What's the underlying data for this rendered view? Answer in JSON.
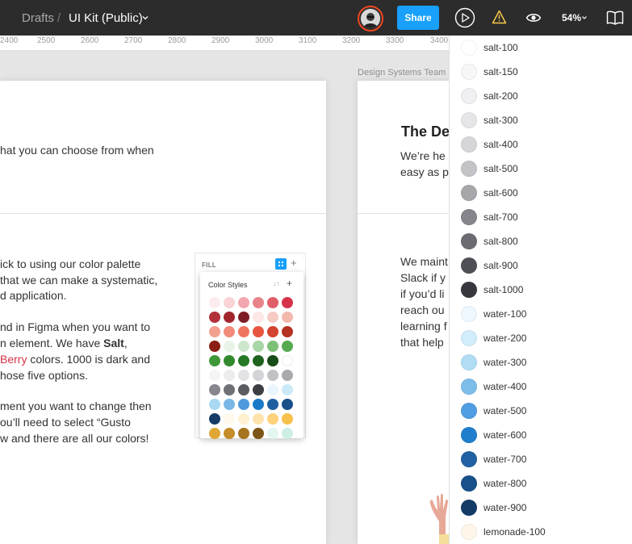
{
  "topbar": {
    "breadcrumb_parent": "Drafts",
    "breadcrumb_sep": "/",
    "file_name": "UI Kit (Public)",
    "share_label": "Share",
    "zoom": "54%"
  },
  "ruler": {
    "ticks": [
      "2400",
      "2500",
      "2600",
      "2700",
      "2800",
      "2900",
      "3000",
      "3100",
      "3200",
      "3300",
      "3400"
    ]
  },
  "canvas": {
    "frame_label": "Design Systems Team",
    "left_top_text": "hat you can choose from when",
    "left_para1": [
      "ick to using our color palette",
      "that we can make a systematic,",
      "d application."
    ],
    "left_para2_line1": "nd in Figma when you want to",
    "left_para2_line2_a": "n element. We have ",
    "left_para2_line2_b": "Salt",
    "left_para2_line2_c": ",",
    "left_para2_line3_a": "Berry",
    "left_para2_line3_b": " colors. 1000 is dark and",
    "left_para2_line4": "hose five options.",
    "left_para3": [
      "ment you want to change then",
      "ou’ll need to select “Gusto",
      "w and there are all our colors!"
    ],
    "right_heading": "The De",
    "right_intro": [
      "We’re he",
      "easy as p"
    ],
    "right_para": [
      "We maint",
      "Slack if y",
      "if you’d li",
      "reach ou",
      "learning f",
      "that help"
    ],
    "fill_panel": {
      "label": "FILL",
      "plus": "+",
      "popover_title": "Color Styles",
      "popover_sort": "↓↑",
      "popover_plus": "+",
      "swatch_rows": [
        [
          "#fdecee",
          "#f9d3d6",
          "#f1a7ad",
          "#e9838a",
          "#e05e67",
          "#d6334a"
        ],
        [
          "#b2303a",
          "#a3262f",
          "#7f1d25",
          "#fde6e6",
          "#f6cbc4",
          "#f3b9ad"
        ],
        [
          "#f29f90",
          "#f28b7a",
          "#f07460",
          "#e7553f",
          "#d3432f",
          "#b43322"
        ],
        [
          "#8c1f14",
          "#e9f4e9",
          "#cde7cc",
          "#a8d5a5",
          "#7cc077",
          "#56a94f"
        ],
        [
          "#3e9837",
          "#338a2e",
          "#277a25",
          "#1f6320",
          "#174c18",
          "#ffffff"
        ],
        [
          "#f4f4f5",
          "#ececee",
          "#e3e3e6",
          "#d4d4d8",
          "#c2c2c6",
          "#a8a8ad"
        ],
        [
          "#86868c",
          "#6f6f76",
          "#5b5b62",
          "#3d3d44",
          "#eaf6fd",
          "#cce9f8"
        ],
        [
          "#a9d8f2",
          "#7ab7e6",
          "#4f98dd",
          "#1b7ac8",
          "#1f5fa1",
          "#18508a"
        ],
        [
          "#153b66",
          "#fff9ec",
          "#fff0d0",
          "#ffe3ad",
          "#ffd17c",
          "#f7c04a"
        ],
        [
          "#e0a736",
          "#c48d2a",
          "#a6731f",
          "#7d5516",
          "#e4f6f1",
          "#cdeee5"
        ]
      ]
    }
  },
  "color_styles": [
    {
      "name": "salt-100",
      "color": "#ffffff"
    },
    {
      "name": "salt-150",
      "color": "#f7f7f8"
    },
    {
      "name": "salt-200",
      "color": "#f0f0f2"
    },
    {
      "name": "salt-300",
      "color": "#e6e6e8"
    },
    {
      "name": "salt-400",
      "color": "#d6d6d9"
    },
    {
      "name": "salt-500",
      "color": "#c4c4c8"
    },
    {
      "name": "salt-600",
      "color": "#a6a6ab"
    },
    {
      "name": "salt-700",
      "color": "#85858b"
    },
    {
      "name": "salt-800",
      "color": "#6b6b71"
    },
    {
      "name": "salt-900",
      "color": "#4f4f56"
    },
    {
      "name": "salt-1000",
      "color": "#37373d"
    },
    {
      "name": "water-100",
      "color": "#eef8fe"
    },
    {
      "name": "water-200",
      "color": "#d1ecfa"
    },
    {
      "name": "water-300",
      "color": "#b0ddf4"
    },
    {
      "name": "water-400",
      "color": "#7cbde9"
    },
    {
      "name": "water-500",
      "color": "#4f9de2"
    },
    {
      "name": "water-600",
      "color": "#1f7fcc"
    },
    {
      "name": "water-700",
      "color": "#2161a3"
    },
    {
      "name": "water-800",
      "color": "#18508b"
    },
    {
      "name": "water-900",
      "color": "#143b66"
    },
    {
      "name": "lemonade-100",
      "color": "#fff6ea"
    }
  ]
}
